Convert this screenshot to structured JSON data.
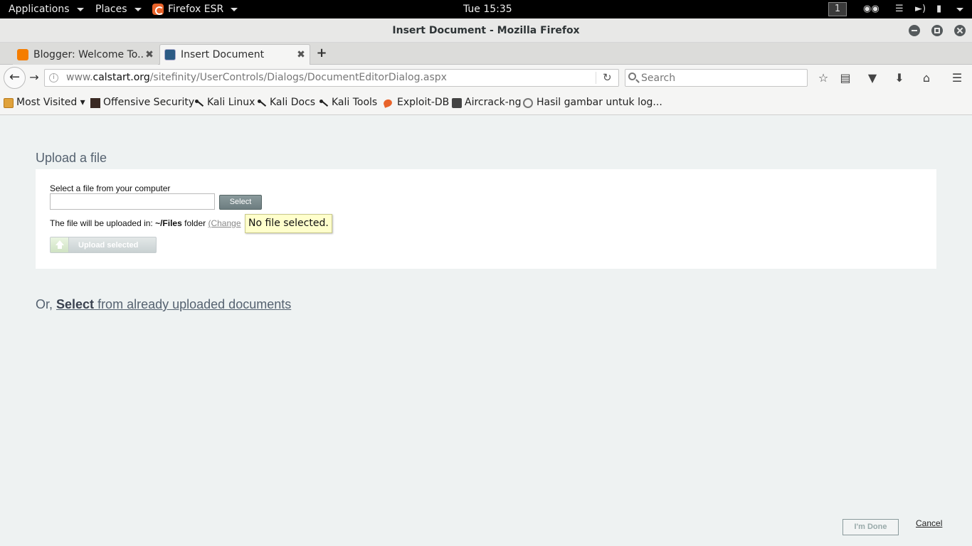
{
  "topbar": {
    "applications": "Applications",
    "places": "Places",
    "firefox": "Firefox ESR",
    "clock": "Tue 15:35",
    "workspace": "1"
  },
  "window": {
    "title": "Insert Document - Mozilla Firefox"
  },
  "tabs": [
    {
      "label": "Blogger: Welcome To...",
      "active": false,
      "favicon": "blogger-icon"
    },
    {
      "label": "Insert Document",
      "active": true,
      "favicon": "document-icon"
    }
  ],
  "navbar": {
    "url_host_prefix": "www.",
    "url_host": "calstart.org",
    "url_path": "/sitefinity/UserControls/Dialogs/DocumentEditorDialog.aspx",
    "search_placeholder": "Search"
  },
  "bookmarks": [
    {
      "label": "Most Visited ▾",
      "icon": "folder-icon"
    },
    {
      "label": "Offensive Security",
      "icon": "offensive-security-icon"
    },
    {
      "label": "Kali Linux",
      "icon": "kali-icon"
    },
    {
      "label": "Kali Docs",
      "icon": "kali-icon"
    },
    {
      "label": "Kali Tools",
      "icon": "kali-icon"
    },
    {
      "label": "Exploit-DB",
      "icon": "exploit-db-icon"
    },
    {
      "label": "Aircrack-ng",
      "icon": "aircrack-icon"
    },
    {
      "label": "Hasil gambar untuk log...",
      "icon": "globe-icon"
    }
  ],
  "page": {
    "upload_heading": "Upload a file",
    "select_label": "Select a file from your computer",
    "select_button": "Select",
    "upload_dest_prefix": "The file will be uploaded in: ",
    "upload_dest_folder": "~/Files",
    "upload_dest_suffix": " folder ",
    "change_link": "(Change",
    "tooltip": "No file selected.",
    "upload_selected": "Upload selected",
    "or_prefix": "Or, ",
    "or_select": "Select",
    "or_suffix": " from already uploaded documents",
    "done_button": "I'm Done",
    "cancel_link": "Cancel"
  }
}
